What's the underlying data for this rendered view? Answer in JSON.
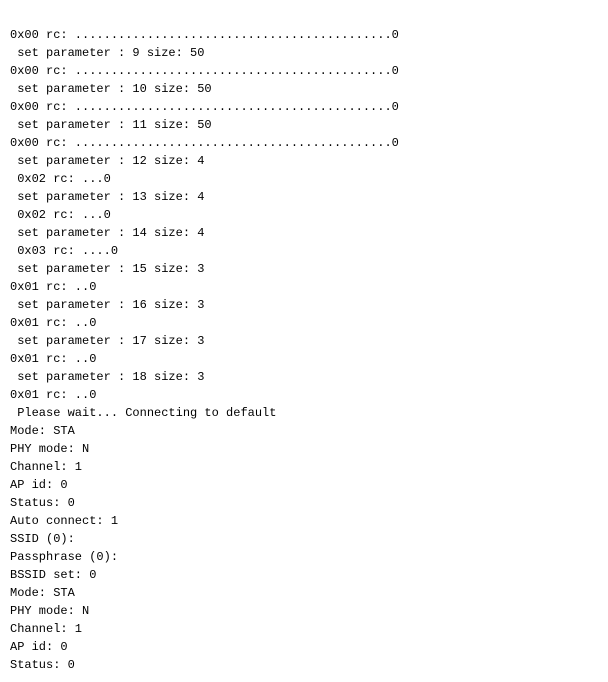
{
  "terminal": {
    "lines": [
      "0x00 rc: ............................................0",
      " set parameter : 9 size: 50",
      "0x00 rc: ............................................0",
      " set parameter : 10 size: 50",
      "0x00 rc: ............................................0",
      " set parameter : 11 size: 50",
      "0x00 rc: ............................................0",
      " set parameter : 12 size: 4",
      " 0x02 rc: ...0",
      " set parameter : 13 size: 4",
      " 0x02 rc: ...0",
      " set parameter : 14 size: 4",
      " 0x03 rc: ....0",
      " set parameter : 15 size: 3",
      "0x01 rc: ..0",
      " set parameter : 16 size: 3",
      "0x01 rc: ..0",
      " set parameter : 17 size: 3",
      "0x01 rc: ..0",
      " set parameter : 18 size: 3",
      "0x01 rc: ..0",
      "",
      " Please wait... Connecting to default",
      "Mode: STA",
      "PHY mode: N",
      "Channel: 1",
      "AP id: 0",
      "Status: 0",
      "Auto connect: 1",
      "SSID (0):",
      "Passphrase (0):",
      "BSSID set: 0",
      "Mode: STA",
      "PHY mode: N",
      "Channel: 1",
      "AP id: 0",
      "Status: 0"
    ]
  }
}
